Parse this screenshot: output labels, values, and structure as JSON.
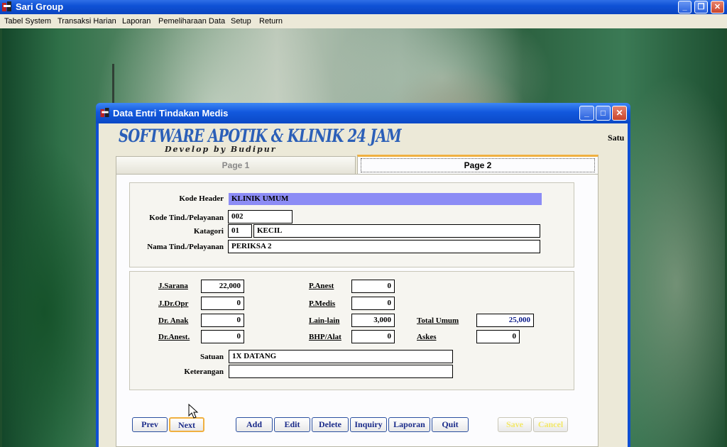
{
  "main_window": {
    "title": "Sari Group",
    "controls": {
      "minimize": "_",
      "maximize": "❐",
      "close": "✕"
    }
  },
  "menu": [
    "Tabel System",
    "Transaksi Harian",
    "Laporan",
    "Pemeliharaan Data",
    "Setup",
    "Return"
  ],
  "child_window": {
    "title": "Data Entri Tindakan Medis",
    "controls": {
      "minimize": "_",
      "maximize": "□",
      "close": "✕"
    },
    "logo": {
      "main": "SOFTWARE APOTIK & KLINIK 24 JAM",
      "sub": "Develop by Budipur"
    },
    "clipped_label": "Satu",
    "tabs": [
      {
        "label": "Page 1",
        "active": false
      },
      {
        "label": "Page 2",
        "active": true
      }
    ],
    "header_group": {
      "kode_header": {
        "label": "Kode Header",
        "value": "KLINIK UMUM"
      },
      "kode_tind": {
        "label": "Kode Tind./Pelayanan",
        "value": "002"
      },
      "katagori": {
        "label": "Katagori",
        "code": "01",
        "name": "KECIL"
      },
      "nama_tind": {
        "label": "Nama Tind./Pelayanan",
        "value": "PERIKSA 2"
      }
    },
    "cost_group": {
      "j_sarana": {
        "label": "J.Sarana",
        "value": "22,000"
      },
      "j_dr_opr": {
        "label": "J.Dr.Opr",
        "value": "0"
      },
      "dr_anak": {
        "label": "Dr. Anak",
        "value": "0"
      },
      "dr_anest": {
        "label": "Dr.Anest.",
        "value": "0"
      },
      "p_anest": {
        "label": "P.Anest",
        "value": "0"
      },
      "p_medis": {
        "label": "P.Medis",
        "value": "0"
      },
      "lain_lain": {
        "label": "Lain-lain",
        "value": "3,000"
      },
      "bhp_alat": {
        "label": "BHP/Alat",
        "value": "0"
      },
      "total_umum": {
        "label": "Total Umum",
        "value": "25,000"
      },
      "askes": {
        "label": "Askes",
        "value": "0"
      },
      "satuan": {
        "label": "Satuan",
        "value": "1X DATANG"
      },
      "keterangan": {
        "label": "Keterangan",
        "value": ""
      }
    },
    "buttons": {
      "prev": "Prev",
      "next": "Next",
      "add": "Add",
      "edit": "Edit",
      "delete": "Delete",
      "inquiry": "Inquiry",
      "laporan": "Laporan",
      "quit": "Quit",
      "save": "Save",
      "cancel": "Cancel"
    }
  },
  "colors": {
    "titlebar": "#0f52d6",
    "highlight_field": "#8c8cf5",
    "tab_active_accent": "#f0b040",
    "button_text": "#1a2b8a",
    "disabled_button_text": "#f3e868"
  }
}
